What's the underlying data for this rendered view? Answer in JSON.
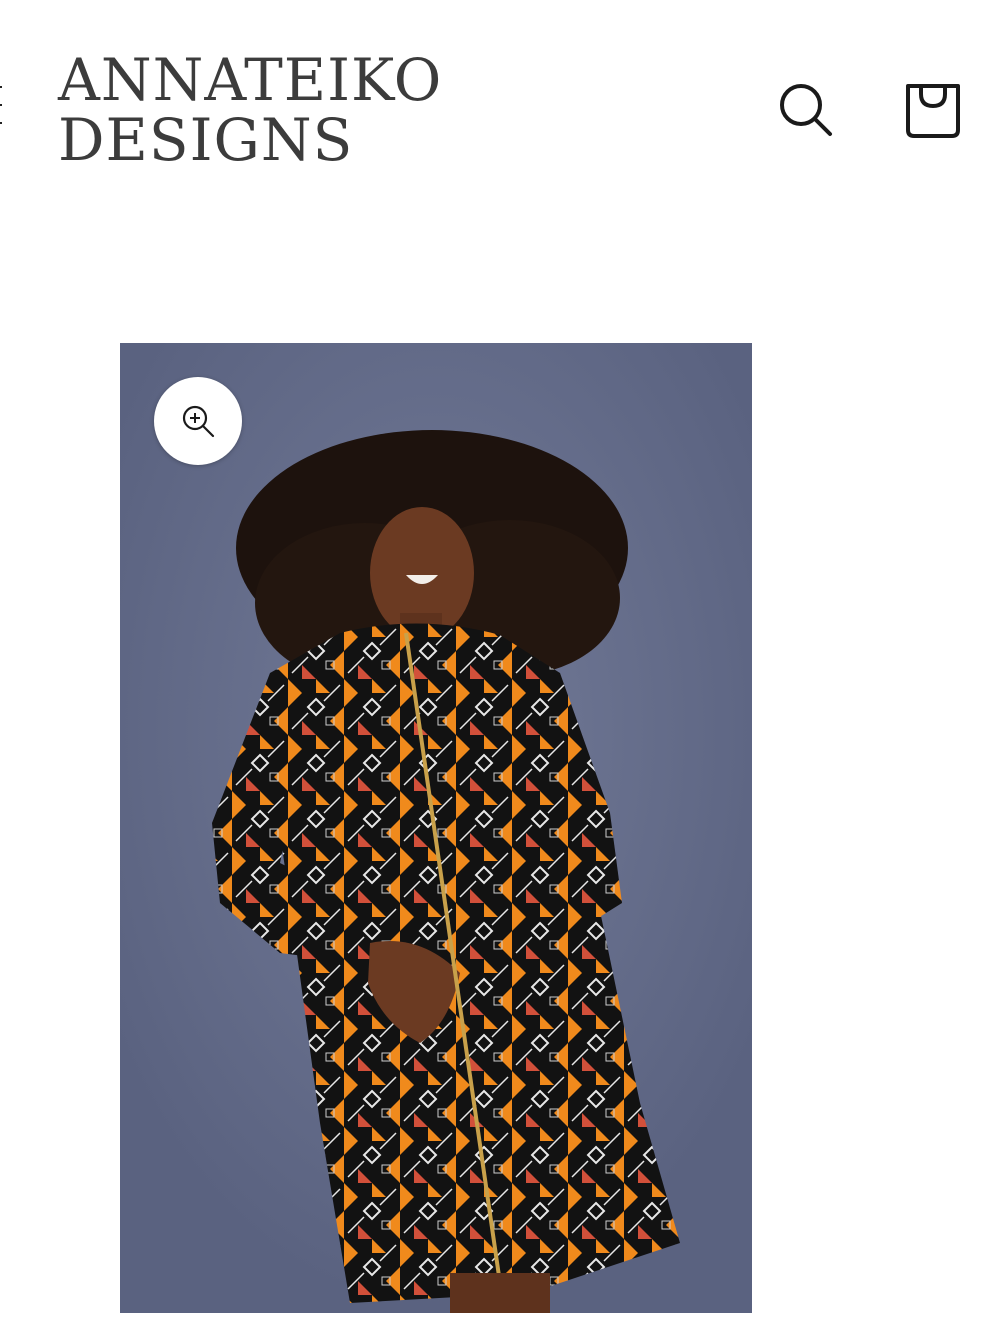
{
  "header": {
    "logo_line1": "ANNATEIKO",
    "logo_line2": "DESIGNS",
    "menu_icon": "hamburger-icon",
    "search_icon": "search-icon",
    "cart_icon": "shopping-bag-icon"
  },
  "product_gallery": {
    "image_description_icon": "product-photo",
    "zoom_icon": "zoom-in-icon"
  },
  "colors": {
    "logo_text": "#3c3c3c",
    "photo_background": "#646c89",
    "print_orange": "#f08a1c",
    "print_black": "#121212"
  }
}
